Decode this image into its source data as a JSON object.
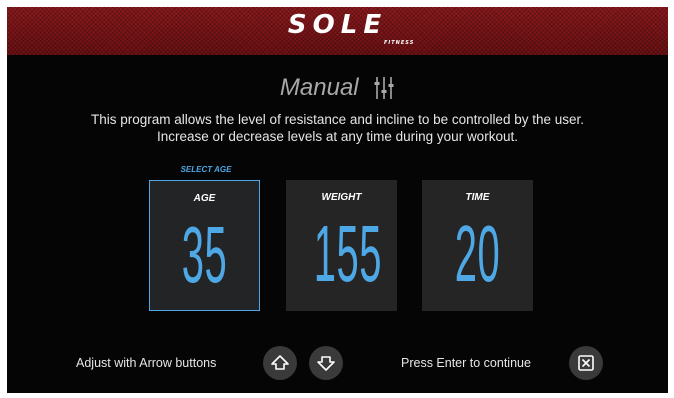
{
  "brand": {
    "logo_text": "SOLE",
    "logo_sub": "FITNESS",
    "header_color": "#7d1518"
  },
  "program": {
    "title": "Manual",
    "title_icon": "sliders-icon",
    "description_line1": "This program allows the level of resistance and incline to be controlled by the user.",
    "description_line2": "Increase or decrease levels at any time during your workout."
  },
  "selection_prompt": "SELECT AGE",
  "settings": [
    {
      "label": "AGE",
      "value": "35",
      "selected": true
    },
    {
      "label": "WEIGHT",
      "value": "155",
      "selected": false
    },
    {
      "label": "TIME",
      "value": "20",
      "selected": false
    }
  ],
  "footer": {
    "adjust_text": "Adjust with Arrow buttons",
    "up_icon": "arrow-up-icon",
    "down_icon": "arrow-down-icon",
    "enter_text": "Press Enter to continue",
    "enter_icon": "enter-x-icon"
  },
  "colors": {
    "accent": "#4fa8e6",
    "background": "#050505",
    "tile": "#252525",
    "button": "#3a3a3a"
  }
}
